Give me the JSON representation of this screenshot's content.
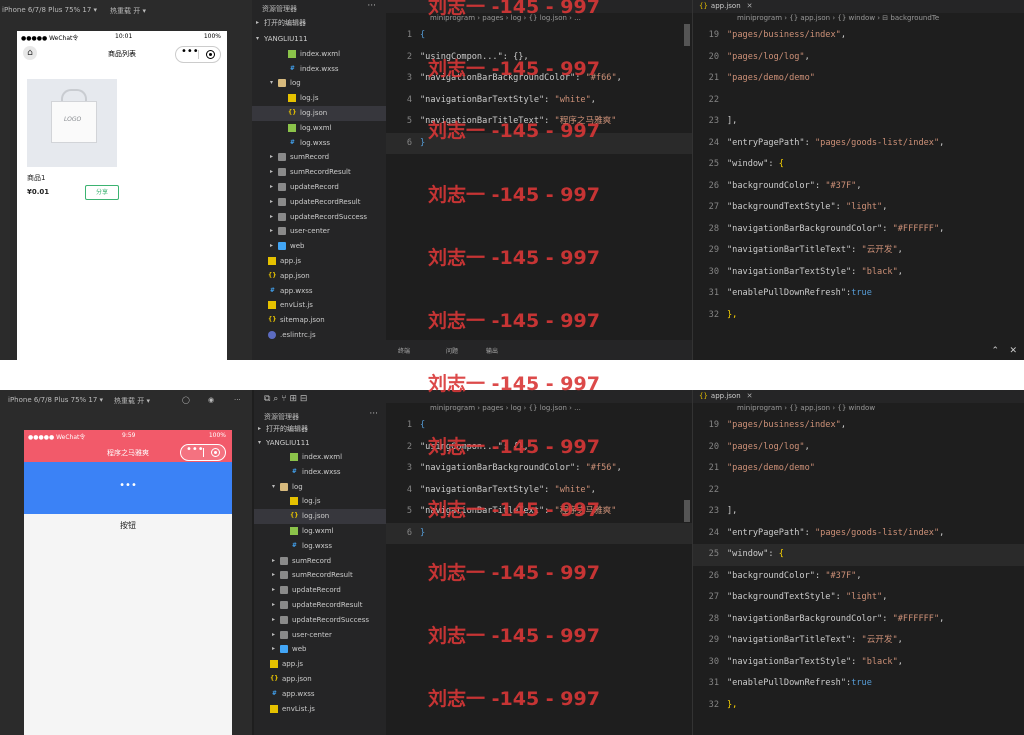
{
  "top": {
    "sim_toolbar": [
      "iPhone 6/7/8 Plus 75% 17 ▾",
      "热重载 开 ▾"
    ],
    "phone": {
      "carrier": "●●●●● WeChat令",
      "time": "10:01",
      "battery": "100%",
      "title": "商品列表",
      "product_name": "商品1",
      "product_price": "¥0.01",
      "share_label": "分享",
      "bag_logo": "LOGO"
    },
    "explorer_title": "资源管理器",
    "explorer_sections": [
      "打开的编辑器",
      "YANGLIU111"
    ],
    "tree": [
      {
        "label": "index.wxml",
        "icon": "wxml",
        "depth": 3
      },
      {
        "label": "index.wxss",
        "icon": "wxss",
        "depth": 3
      },
      {
        "label": "log",
        "icon": "folder-open",
        "depth": 2,
        "arrow": "▾"
      },
      {
        "label": "log.js",
        "icon": "js",
        "depth": 3
      },
      {
        "label": "log.json",
        "icon": "json",
        "depth": 3,
        "selected": true
      },
      {
        "label": "log.wxml",
        "icon": "wxml",
        "depth": 3
      },
      {
        "label": "log.wxss",
        "icon": "wxss",
        "depth": 3
      },
      {
        "label": "sumRecord",
        "icon": "folder",
        "depth": 2,
        "arrow": "▸"
      },
      {
        "label": "sumRecordResult",
        "icon": "folder",
        "depth": 2,
        "arrow": "▸"
      },
      {
        "label": "updateRecord",
        "icon": "folder",
        "depth": 2,
        "arrow": "▸"
      },
      {
        "label": "updateRecordResult",
        "icon": "folder",
        "depth": 2,
        "arrow": "▸"
      },
      {
        "label": "updateRecordSuccess",
        "icon": "folder",
        "depth": 2,
        "arrow": "▸"
      },
      {
        "label": "user-center",
        "icon": "folder",
        "depth": 2,
        "arrow": "▸"
      },
      {
        "label": "web",
        "icon": "web",
        "depth": 2,
        "arrow": "▸"
      },
      {
        "label": "app.js",
        "icon": "js",
        "depth": 1
      },
      {
        "label": "app.json",
        "icon": "json",
        "depth": 1
      },
      {
        "label": "app.wxss",
        "icon": "wxss",
        "depth": 1
      },
      {
        "label": "envList.js",
        "icon": "js",
        "depth": 1
      },
      {
        "label": "sitemap.json",
        "icon": "json",
        "depth": 1
      },
      {
        "label": ".eslintrc.js",
        "icon": "eslint",
        "depth": 1
      }
    ],
    "editor1": {
      "crumbs": "miniprogram › pages › log › {} log.json › ...",
      "lines": [
        {
          "n": "1",
          "parts": [
            [
              "b",
              "{"
            ]
          ]
        },
        {
          "n": "2",
          "parts": [
            [
              "k",
              "  \"usingCompon...\": {},"
            ]
          ]
        },
        {
          "n": "3",
          "parts": [
            [
              "k",
              "  \"navigationBarBackgroundColor\": "
            ],
            [
              "s",
              "\"#f66\""
            ],
            [
              "pn",
              ","
            ]
          ]
        },
        {
          "n": "4",
          "parts": [
            [
              "k",
              "  \"navigationBarTextStyle\": "
            ],
            [
              "s",
              "\"white\""
            ],
            [
              "pn",
              ","
            ]
          ]
        },
        {
          "n": "5",
          "parts": [
            [
              "k",
              "  \"navigationBarTitleText\": "
            ],
            [
              "s",
              "\"程序之马雅爽\""
            ]
          ]
        },
        {
          "n": "6",
          "parts": [
            [
              "b",
              "}"
            ]
          ],
          "hl": true
        }
      ],
      "bottom": [
        "终端",
        "问题",
        "输出"
      ]
    },
    "editor2": {
      "tab": "app.json",
      "crumbs": "miniprogram › {} app.json › {} window › ⊟ backgroundTe",
      "lines": [
        {
          "n": "19",
          "parts": [
            [
              "s",
              "    \"pages/business/index\""
            ],
            [
              "pn",
              ","
            ]
          ]
        },
        {
          "n": "20",
          "parts": [
            [
              "s",
              "    \"pages/log/log\""
            ],
            [
              "pn",
              ","
            ]
          ]
        },
        {
          "n": "21",
          "parts": [
            [
              "s",
              "    \"pages/demo/demo\""
            ]
          ]
        },
        {
          "n": "22",
          "parts": []
        },
        {
          "n": "23",
          "parts": [
            [
              "pn",
              "  ],"
            ]
          ]
        },
        {
          "n": "24",
          "parts": [
            [
              "k",
              "  \"entryPagePath\": "
            ],
            [
              "s",
              "\"pages/goods-list/index\""
            ],
            [
              "pn",
              ","
            ]
          ]
        },
        {
          "n": "25",
          "parts": [
            [
              "k",
              "  \"window\": "
            ],
            [
              "brace",
              "{"
            ]
          ]
        },
        {
          "n": "26",
          "parts": [
            [
              "k",
              "    \"backgroundColor\": "
            ],
            [
              "s",
              "\"#37F\""
            ],
            [
              "pn",
              ","
            ]
          ]
        },
        {
          "n": "27",
          "parts": [
            [
              "k",
              "    \"backgroundTextStyle\": "
            ],
            [
              "s",
              "\"light\""
            ],
            [
              "pn",
              ","
            ]
          ]
        },
        {
          "n": "28",
          "parts": [
            [
              "k",
              "    \"navigationBarBackgroundColor\": "
            ],
            [
              "s",
              "\"#FFFFFF\""
            ],
            [
              "pn",
              ","
            ]
          ]
        },
        {
          "n": "29",
          "parts": [
            [
              "k",
              "    \"navigationBarTitleText\": "
            ],
            [
              "s",
              "\"云开发\""
            ],
            [
              "pn",
              ","
            ]
          ]
        },
        {
          "n": "30",
          "parts": [
            [
              "k",
              "    \"navigationBarTextStyle\": "
            ],
            [
              "s",
              "\"black\""
            ],
            [
              "pn",
              ","
            ]
          ]
        },
        {
          "n": "31",
          "parts": [
            [
              "k",
              "    \"enablePullDownRefresh\":"
            ],
            [
              "b",
              "true"
            ]
          ]
        },
        {
          "n": "32",
          "parts": [
            [
              "brace",
              "  },"
            ]
          ]
        }
      ]
    }
  },
  "bottom": {
    "sim_toolbar": [
      "iPhone 6/7/8 Plus 75% 17 ▾",
      "热重载 开 ▾"
    ],
    "phone": {
      "carrier": "●●●●● WeChat令",
      "time": "9:59",
      "battery": "100%",
      "title": "程序之马雅爽",
      "dots": "•••",
      "button_label": "按钮"
    },
    "explorer_title": "资源管理器",
    "explorer_sections": [
      "打开的编辑器",
      "YANGLIU111"
    ],
    "tree": [
      {
        "label": "index.wxml",
        "icon": "wxml",
        "depth": 3
      },
      {
        "label": "index.wxss",
        "icon": "wxss",
        "depth": 3
      },
      {
        "label": "log",
        "icon": "folder-open",
        "depth": 2,
        "arrow": "▾"
      },
      {
        "label": "log.js",
        "icon": "js",
        "depth": 3
      },
      {
        "label": "log.json",
        "icon": "json",
        "depth": 3,
        "selected": true
      },
      {
        "label": "log.wxml",
        "icon": "wxml",
        "depth": 3
      },
      {
        "label": "log.wxss",
        "icon": "wxss",
        "depth": 3
      },
      {
        "label": "sumRecord",
        "icon": "folder",
        "depth": 2,
        "arrow": "▸"
      },
      {
        "label": "sumRecordResult",
        "icon": "folder",
        "depth": 2,
        "arrow": "▸"
      },
      {
        "label": "updateRecord",
        "icon": "folder",
        "depth": 2,
        "arrow": "▸"
      },
      {
        "label": "updateRecordResult",
        "icon": "folder",
        "depth": 2,
        "arrow": "▸"
      },
      {
        "label": "updateRecordSuccess",
        "icon": "folder",
        "depth": 2,
        "arrow": "▸"
      },
      {
        "label": "user-center",
        "icon": "folder",
        "depth": 2,
        "arrow": "▸"
      },
      {
        "label": "web",
        "icon": "web",
        "depth": 2,
        "arrow": "▸"
      },
      {
        "label": "app.js",
        "icon": "js",
        "depth": 1
      },
      {
        "label": "app.json",
        "icon": "json",
        "depth": 1
      },
      {
        "label": "app.wxss",
        "icon": "wxss",
        "depth": 1
      },
      {
        "label": "envList.js",
        "icon": "js",
        "depth": 1
      }
    ],
    "editor1": {
      "crumbs": "miniprogram › pages › log › {} log.json › ...",
      "lines": [
        {
          "n": "1",
          "parts": [
            [
              "b",
              "{"
            ]
          ]
        },
        {
          "n": "2",
          "parts": [
            [
              "k",
              "  \"usingCompon...\": {},"
            ]
          ]
        },
        {
          "n": "3",
          "parts": [
            [
              "k",
              "  \"navigationBarBackgroundColor\": "
            ],
            [
              "s",
              "\"#f56\""
            ],
            [
              "pn",
              ","
            ]
          ]
        },
        {
          "n": "4",
          "parts": [
            [
              "k",
              "  \"navigationBarTextStyle\": "
            ],
            [
              "s",
              "\"white\""
            ],
            [
              "pn",
              ","
            ]
          ]
        },
        {
          "n": "5",
          "parts": [
            [
              "k",
              "  \"navigationBarTitleText\": "
            ],
            [
              "s",
              "\"程序之马雅爽\""
            ]
          ]
        },
        {
          "n": "6",
          "parts": [
            [
              "b",
              "}"
            ]
          ],
          "hl": true
        }
      ]
    },
    "editor2": {
      "tab": "app.json",
      "crumbs": "miniprogram › {} app.json › {} window",
      "lines": [
        {
          "n": "19",
          "parts": [
            [
              "s",
              "    \"pages/business/index\""
            ],
            [
              "pn",
              ","
            ]
          ]
        },
        {
          "n": "20",
          "parts": [
            [
              "s",
              "    \"pages/log/log\""
            ],
            [
              "pn",
              ","
            ]
          ]
        },
        {
          "n": "21",
          "parts": [
            [
              "s",
              "    \"pages/demo/demo\""
            ]
          ]
        },
        {
          "n": "22",
          "parts": []
        },
        {
          "n": "23",
          "parts": [
            [
              "pn",
              "  ],"
            ]
          ]
        },
        {
          "n": "24",
          "parts": [
            [
              "k",
              "  \"entryPagePath\": "
            ],
            [
              "s",
              "\"pages/goods-list/index\""
            ],
            [
              "pn",
              ","
            ]
          ]
        },
        {
          "n": "25",
          "parts": [
            [
              "k",
              "  \"window\": "
            ],
            [
              "brace",
              "{"
            ]
          ],
          "hl": true
        },
        {
          "n": "26",
          "parts": [
            [
              "k",
              "    \"backgroundColor\": "
            ],
            [
              "s",
              "\"#37F\""
            ],
            [
              "pn",
              ","
            ]
          ]
        },
        {
          "n": "27",
          "parts": [
            [
              "k",
              "    \"backgroundTextStyle\": "
            ],
            [
              "s",
              "\"light\""
            ],
            [
              "pn",
              ","
            ]
          ]
        },
        {
          "n": "28",
          "parts": [
            [
              "k",
              "    \"navigationBarBackgroundColor\": "
            ],
            [
              "s",
              "\"#FFFFFF\""
            ],
            [
              "pn",
              ","
            ]
          ]
        },
        {
          "n": "29",
          "parts": [
            [
              "k",
              "    \"navigationBarTitleText\": "
            ],
            [
              "s",
              "\"云开发\""
            ],
            [
              "pn",
              ","
            ]
          ]
        },
        {
          "n": "30",
          "parts": [
            [
              "k",
              "    \"navigationBarTextStyle\": "
            ],
            [
              "s",
              "\"black\""
            ],
            [
              "pn",
              ","
            ]
          ]
        },
        {
          "n": "31",
          "parts": [
            [
              "k",
              "    \"enablePullDownRefresh\":"
            ],
            [
              "b",
              "true"
            ]
          ]
        },
        {
          "n": "32",
          "parts": [
            [
              "brace",
              "  },"
            ]
          ]
        }
      ]
    }
  },
  "watermark": "刘志一 -145 - 997",
  "colors": {
    "editor_bg": "#1e1e1e",
    "sidebar_bg": "#252526",
    "string": "#ce9178",
    "key": "#cccccc",
    "nav_red": "#f25a6a",
    "blue_block": "#3b82f6",
    "watermark_red": "#d93737"
  }
}
